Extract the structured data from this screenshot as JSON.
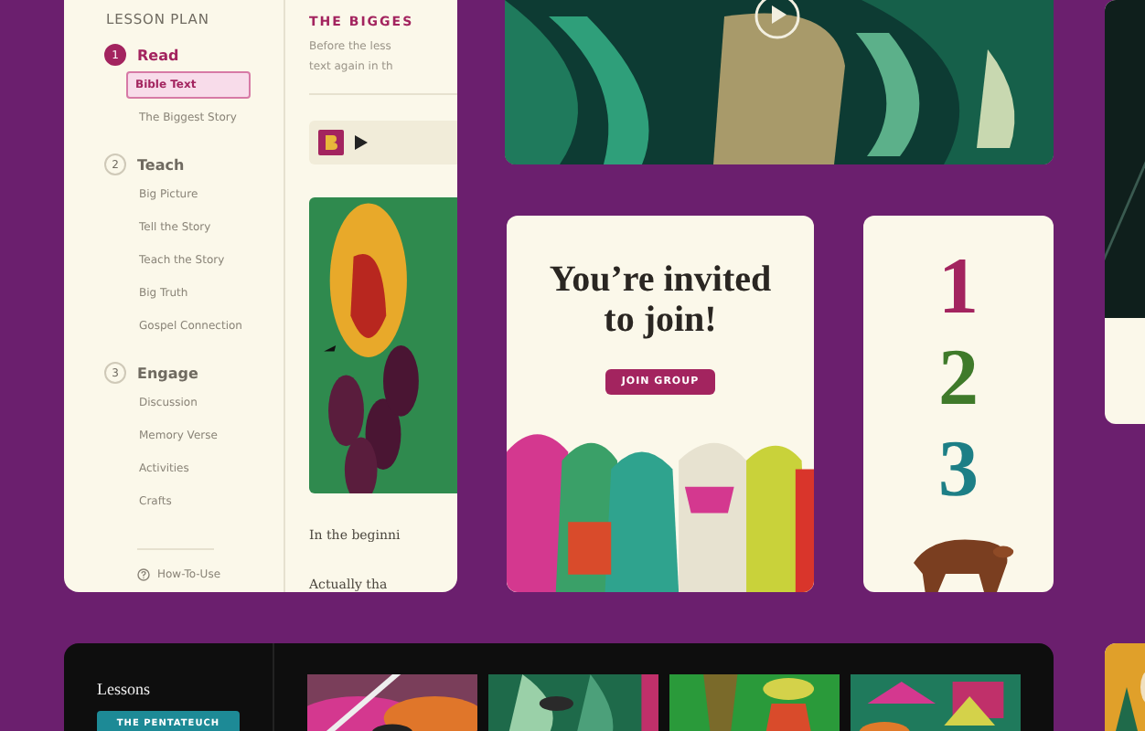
{
  "lesson_window": {
    "sidebar": {
      "title": "LESSON PLAN",
      "sections": [
        {
          "number": "1",
          "title": "Read",
          "selected": true,
          "items": [
            {
              "label": "Bible Text",
              "selected": true
            },
            {
              "label": "The Biggest Story",
              "selected": false
            }
          ]
        },
        {
          "number": "2",
          "title": "Teach",
          "selected": false,
          "items": [
            {
              "label": "Big Picture",
              "selected": false
            },
            {
              "label": "Tell the Story",
              "selected": false
            },
            {
              "label": "Teach the Story",
              "selected": false
            },
            {
              "label": "Big Truth",
              "selected": false
            },
            {
              "label": "Gospel Connection",
              "selected": false
            }
          ]
        },
        {
          "number": "3",
          "title": "Engage",
          "selected": false,
          "items": [
            {
              "label": "Discussion",
              "selected": false
            },
            {
              "label": "Memory Verse",
              "selected": false
            },
            {
              "label": "Activities",
              "selected": false
            },
            {
              "label": "Crafts",
              "selected": false
            }
          ]
        }
      ],
      "help_link": "How-To-Use"
    },
    "content": {
      "heading": "THE BIGGES",
      "intro": [
        "Before the less",
        "text again in th"
      ],
      "body": [
        "In the beginni",
        "Actually tha"
      ]
    }
  },
  "invite_card": {
    "title": "You’re invited to join!",
    "button": "JOIN GROUP"
  },
  "numbers_card": {
    "numbers": [
      {
        "text": "1",
        "color": "#a3245f"
      },
      {
        "text": "2",
        "color": "#3f7a2a"
      },
      {
        "text": "3",
        "color": "#1d7f86"
      }
    ]
  },
  "lessons_panel": {
    "title": "Lessons",
    "button": "THE PENTATEUCH"
  }
}
